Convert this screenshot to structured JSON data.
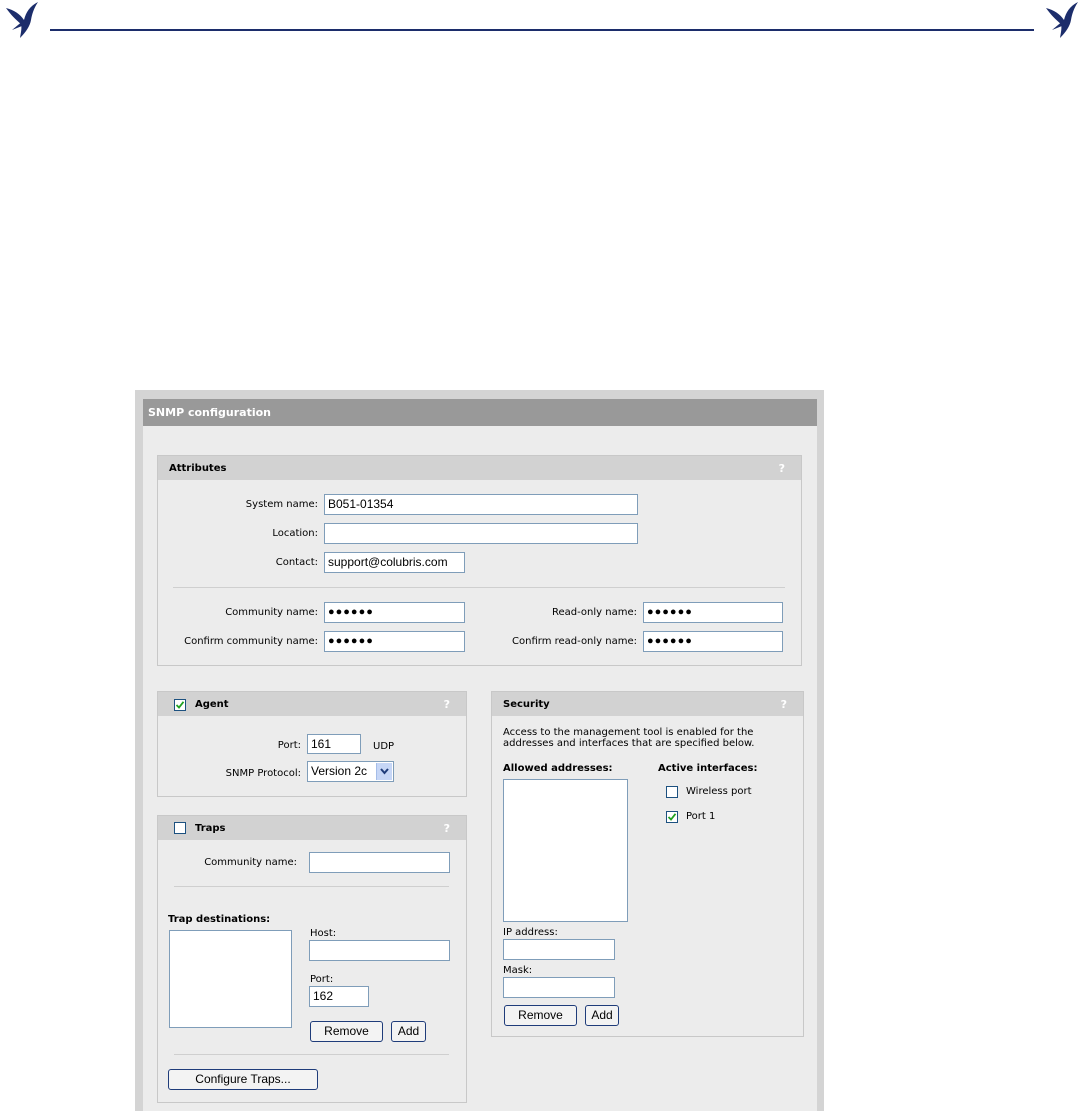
{
  "page": {
    "panel_title": "SNMP configuration"
  },
  "attributes": {
    "title": "Attributes",
    "help": "?",
    "system_name_label": "System name:",
    "system_name_value": "B051-01354",
    "location_label": "Location:",
    "location_value": "",
    "contact_label": "Contact:",
    "contact_value": "support@colubris.com",
    "community_name_label": "Community name:",
    "community_name_value": "●●●●●●",
    "confirm_community_label": "Confirm community name:",
    "confirm_community_value": "●●●●●●",
    "readonly_name_label": "Read-only name:",
    "readonly_name_value": "●●●●●●",
    "confirm_readonly_label": "Confirm read-only name:",
    "confirm_readonly_value": "●●●●●●"
  },
  "agent": {
    "title": "Agent",
    "checked": true,
    "help": "?",
    "port_label": "Port:",
    "port_value": "161",
    "port_unit": "UDP",
    "protocol_label": "SNMP Protocol:",
    "protocol_value": "Version 2c"
  },
  "traps": {
    "title": "Traps",
    "checked": false,
    "help": "?",
    "community_label": "Community name:",
    "community_value": "",
    "destinations_label": "Trap destinations:",
    "host_label": "Host:",
    "host_value": "",
    "port_label": "Port:",
    "port_value": "162",
    "remove_label": "Remove",
    "add_label": "Add",
    "configure_label": "Configure Traps..."
  },
  "security": {
    "title": "Security",
    "help": "?",
    "description": "Access to the management tool is enabled for the addresses and interfaces that are specified below.",
    "allowed_label": "Allowed addresses:",
    "active_label": "Active interfaces:",
    "interfaces": [
      {
        "label": "Wireless port",
        "checked": false
      },
      {
        "label": "Port 1",
        "checked": true
      }
    ],
    "ip_label": "IP address:",
    "ip_value": "",
    "mask_label": "Mask:",
    "mask_value": "",
    "remove_label": "Remove",
    "add_label": "Add"
  },
  "colors": {
    "title_bar": "#999999",
    "section_head": "#d2d2d2",
    "panel_bg": "#ececec",
    "logo_blue": "#1c2d6b"
  },
  "icons": {
    "logo": "hummingbird-logo-icon",
    "check": "checkmark-icon",
    "dropdown": "chevron-down-icon"
  }
}
